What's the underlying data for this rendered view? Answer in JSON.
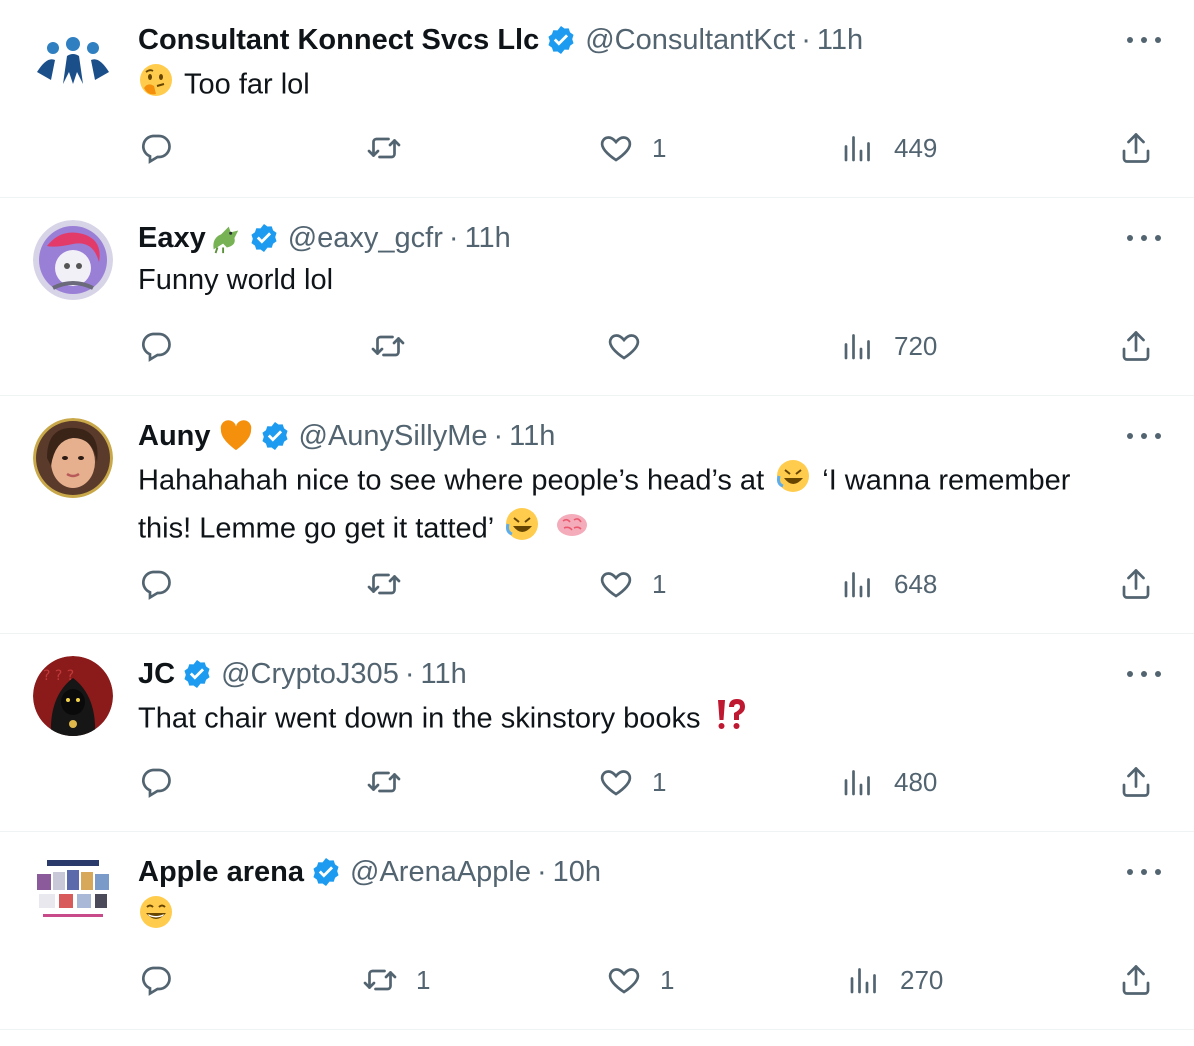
{
  "tweets": [
    {
      "name": "Consultant Konnect Svcs Llc",
      "handle": "@ConsultantKct",
      "time": "11h",
      "text": "Too far lol",
      "replies": "",
      "retweets": "",
      "likes": "1",
      "views": "449"
    },
    {
      "name": "Eaxy",
      "handle": "@eaxy_gcfr",
      "time": "11h",
      "text": "Funny world lol",
      "replies": "",
      "retweets": "",
      "likes": "",
      "views": "720"
    },
    {
      "name": "Auny",
      "handle": "@AunySillyMe",
      "time": "11h",
      "text_line1": "Hahahahah nice to see where people’s head’s at",
      "text_line1b": "‘I wanna remember",
      "text_line2": "this! Lemme go get it tatted’",
      "replies": "",
      "retweets": "",
      "likes": "1",
      "views": "648"
    },
    {
      "name": "JC",
      "handle": "@CryptoJ305",
      "time": "11h",
      "text": "That chair went down in the skinstory books",
      "replies": "",
      "retweets": "",
      "likes": "1",
      "views": "480"
    },
    {
      "name": "Apple arena",
      "handle": "@ArenaApple",
      "time": "10h",
      "text": "",
      "replies": "",
      "retweets": "1",
      "likes": "1",
      "views": "270"
    }
  ],
  "separator": "·",
  "colors": {
    "text": "#0f1419",
    "secondary": "#536471",
    "verified": "#1d9bf0",
    "border": "#eff3f4"
  }
}
